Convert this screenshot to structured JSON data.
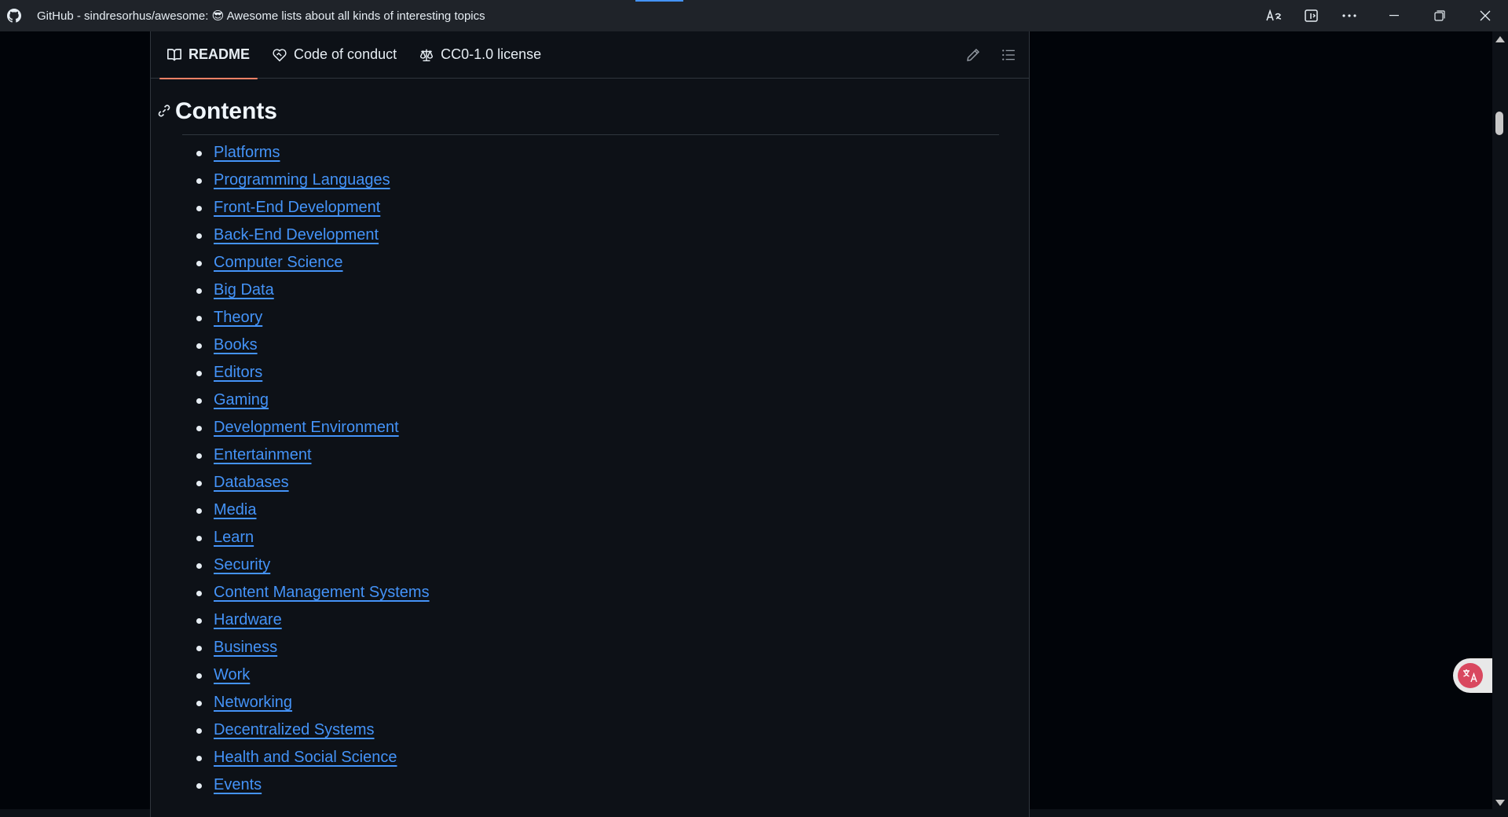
{
  "window": {
    "title": "GitHub - sindresorhus/awesome: 😎 Awesome lists about all kinds of interesting topics",
    "icons": {
      "read_aloud": "read-aloud-icon",
      "immersive_reader": "immersive-reader-icon",
      "more": "more-icon",
      "minimize": "minimize-icon",
      "restore": "restore-icon",
      "close": "close-icon"
    }
  },
  "readme": {
    "tabs": [
      {
        "label": "README",
        "icon": "book-icon",
        "active": true
      },
      {
        "label": "Code of conduct",
        "icon": "heart-shield-icon",
        "active": false
      },
      {
        "label": "CC0-1.0 license",
        "icon": "scale-icon",
        "active": false
      }
    ],
    "actions": {
      "edit": "pencil-icon",
      "outline": "list-icon"
    },
    "heading": "Contents",
    "toc": [
      "Platforms",
      "Programming Languages",
      "Front-End Development",
      "Back-End Development",
      "Computer Science",
      "Big Data",
      "Theory",
      "Books",
      "Editors",
      "Gaming",
      "Development Environment",
      "Entertainment",
      "Databases",
      "Media",
      "Learn",
      "Security",
      "Content Management Systems",
      "Hardware",
      "Business",
      "Work",
      "Networking",
      "Decentralized Systems",
      "Health and Social Science",
      "Events"
    ]
  },
  "colors": {
    "background": "#0d1117",
    "link": "#4493f8",
    "active_tab_underline": "#f78166",
    "border": "#30363d"
  }
}
